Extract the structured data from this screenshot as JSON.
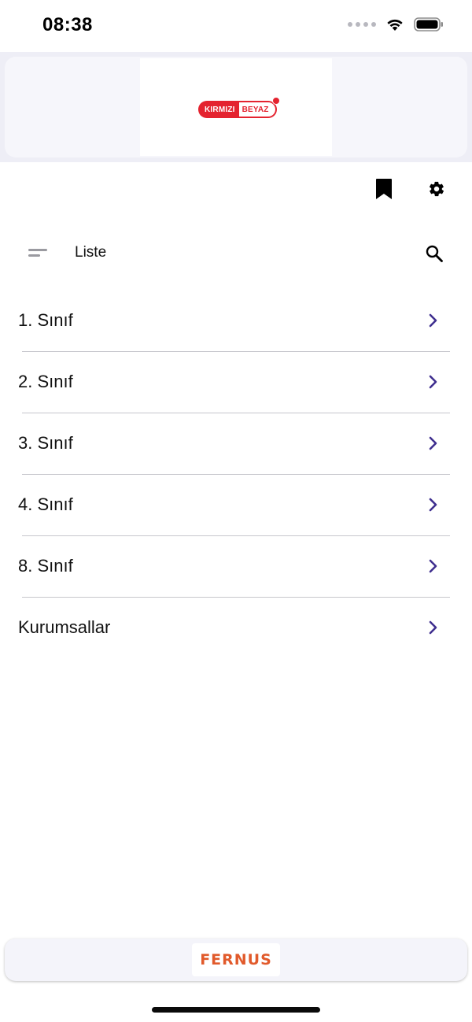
{
  "status_bar": {
    "time": "08:38",
    "icons": [
      "signal-dots-icon",
      "wifi-icon",
      "battery-icon"
    ]
  },
  "header": {
    "logo": {
      "part1": "KIRMIZI",
      "part2": "BEYAZ"
    }
  },
  "toolbar": {
    "icons": [
      "bookmark-icon",
      "gear-icon"
    ]
  },
  "list_header": {
    "title": "Liste",
    "icons": [
      "menu-icon",
      "search-icon"
    ]
  },
  "list": {
    "items": [
      {
        "label": "1. Sınıf"
      },
      {
        "label": "2. Sınıf"
      },
      {
        "label": "3. Sınıf"
      },
      {
        "label": "4. Sınıf"
      },
      {
        "label": "8. Sınıf"
      },
      {
        "label": "Kurumsallar"
      }
    ]
  },
  "footer": {
    "brand": "FERNUS"
  },
  "colors": {
    "accent": "#3f2f8f",
    "logo_red": "#e4232f",
    "footer_brand": "#e15a2b",
    "header_bg": "#eeeef6",
    "divider": "#c6c6cc"
  }
}
